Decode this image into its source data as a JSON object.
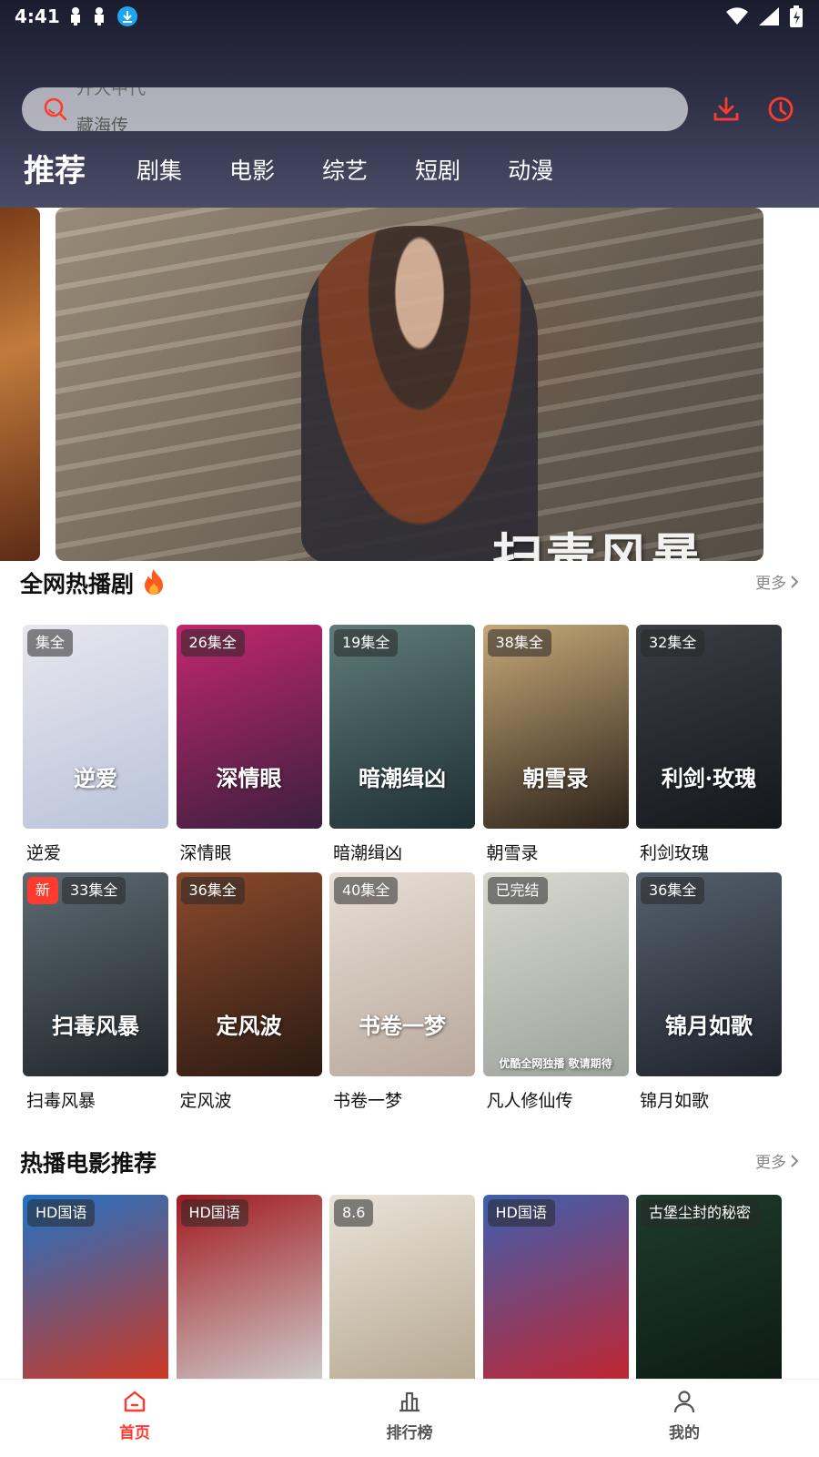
{
  "status_bar": {
    "time": "4:41"
  },
  "search": {
    "previous_hint": "开大中代",
    "placeholder": "藏海传"
  },
  "tabs": [
    {
      "label": "推荐",
      "active": true
    },
    {
      "label": "剧集"
    },
    {
      "label": "电影"
    },
    {
      "label": "综艺"
    },
    {
      "label": "短剧"
    },
    {
      "label": "动漫"
    }
  ],
  "banner": {
    "title": "扫毒风暴"
  },
  "hot_series": {
    "title": "全网热播剧",
    "more": "更多",
    "items": [
      {
        "title": "逆爱",
        "badge": "集全",
        "poster_text": "逆爱",
        "colors": [
          "#e8e6ee",
          "#b9c3d9"
        ]
      },
      {
        "title": "深情眼",
        "badge": "26集全",
        "poster_text": "深情眼",
        "colors": [
          "#c2276d",
          "#3b1f3f"
        ]
      },
      {
        "title": "暗潮缉凶",
        "badge": "19集全",
        "poster_text": "暗潮缉凶",
        "colors": [
          "#5f7b7a",
          "#1e2f33"
        ]
      },
      {
        "title": "朝雪录",
        "badge": "38集全",
        "poster_text": "朝雪录",
        "colors": [
          "#c7a978",
          "#2a2119"
        ]
      },
      {
        "title": "利剑玫瑰",
        "badge": "32集全",
        "poster_text": "利剑·玫瑰",
        "colors": [
          "#3b3f45",
          "#14171c"
        ]
      },
      {
        "title": "扫毒风暴",
        "badge": "33集全",
        "new_badge": "新",
        "poster_text": "扫毒风暴",
        "colors": [
          "#5d6b72",
          "#20262b"
        ]
      },
      {
        "title": "定风波",
        "badge": "36集全",
        "poster_text": "定风波",
        "colors": [
          "#8b4a2c",
          "#2b1a13"
        ]
      },
      {
        "title": "书卷一梦",
        "badge": "40集全",
        "poster_text": "书卷一梦",
        "colors": [
          "#e7dfd5",
          "#b8a79c"
        ]
      },
      {
        "title": "凡人修仙传",
        "badge": "已完结",
        "poster_text": "优酷全网独播 敬请期待",
        "colors": [
          "#d9d9cf",
          "#9ba39b"
        ]
      },
      {
        "title": "锦月如歌",
        "badge": "36集全",
        "poster_text": "锦月如歌",
        "colors": [
          "#55606e",
          "#1f232b"
        ]
      }
    ]
  },
  "hot_movies": {
    "title": "热播电影推荐",
    "more": "更多",
    "items": [
      {
        "badge": "HD国语",
        "colors": [
          "#1f72c7",
          "#d1361f"
        ]
      },
      {
        "badge": "HD国语",
        "colors": [
          "#a11a1f",
          "#cfcfcf"
        ]
      },
      {
        "badge": "8.6",
        "colors": [
          "#e9e3d9",
          "#b5a78f"
        ]
      },
      {
        "badge": "HD国语",
        "colors": [
          "#3d5fb0",
          "#c3242e"
        ]
      },
      {
        "badge": "古堡尘封的秘密",
        "colors": [
          "#1e3b2d",
          "#0d1a14"
        ]
      }
    ]
  },
  "bottom_nav": [
    {
      "label": "首页",
      "active": true
    },
    {
      "label": "排行榜"
    },
    {
      "label": "我的"
    }
  ],
  "colors": {
    "accent": "#ff3b2f",
    "header_dark": "#1b1c2e"
  }
}
